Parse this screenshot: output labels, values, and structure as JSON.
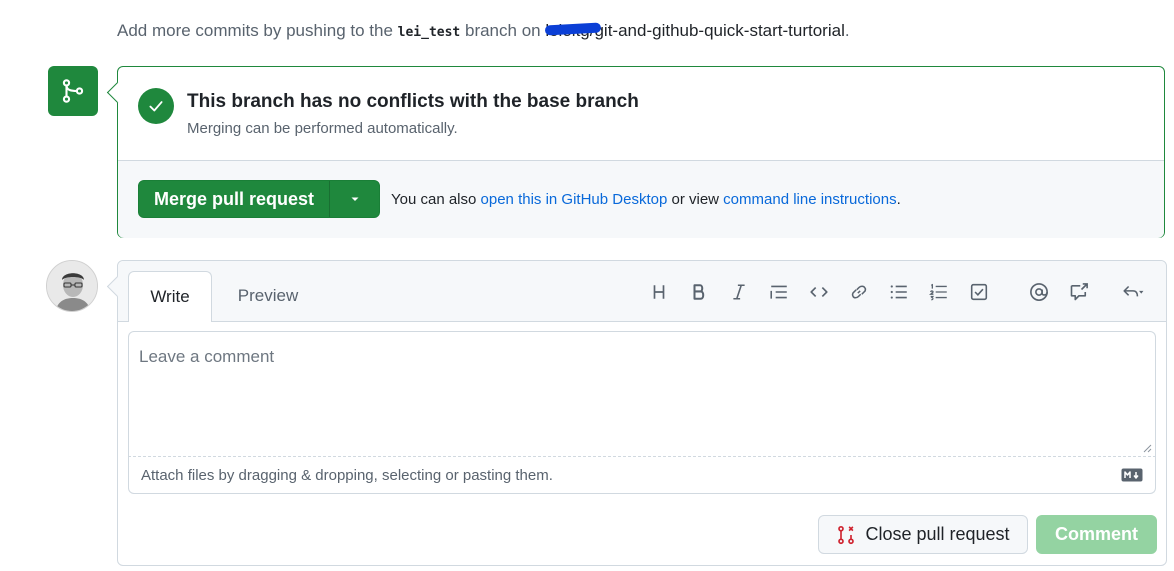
{
  "topline": {
    "prefix": "Add more commits by pushing to the ",
    "branch": "lei_test",
    "middle": " branch on ",
    "repo_owner": "lololtg",
    "repo_name": "/git-and-github-quick-start-turtorial",
    "suffix": "."
  },
  "merge": {
    "icon": "git-merge-icon",
    "status_icon": "check-icon",
    "title": "This branch has no conflicts with the base branch",
    "subtitle": "Merging can be performed automatically.",
    "button_label": "Merge pull request",
    "also_prefix": "You can also ",
    "desktop_link": "open this in GitHub Desktop",
    "also_middle": " or view ",
    "cli_link": "command line instructions",
    "also_suffix": "."
  },
  "comment": {
    "tabs": {
      "write": "Write",
      "preview": "Preview"
    },
    "active_tab": "Write",
    "toolbar": [
      "heading-icon",
      "bold-icon",
      "italic-icon",
      "quote-icon",
      "code-icon",
      "link-icon",
      "unordered-list-icon",
      "ordered-list-icon",
      "task-list-icon",
      "mention-icon",
      "cross-reference-icon",
      "saved-replies-icon"
    ],
    "placeholder": "Leave a comment",
    "attach_text": "Attach files by dragging & dropping, selecting or pasting them.",
    "close_label": "Close pull request",
    "comment_label": "Comment"
  },
  "colors": {
    "success": "#1f883d",
    "comment_disabled": "#94d3a2",
    "link": "#0969da",
    "close_icon": "#cf222e"
  }
}
